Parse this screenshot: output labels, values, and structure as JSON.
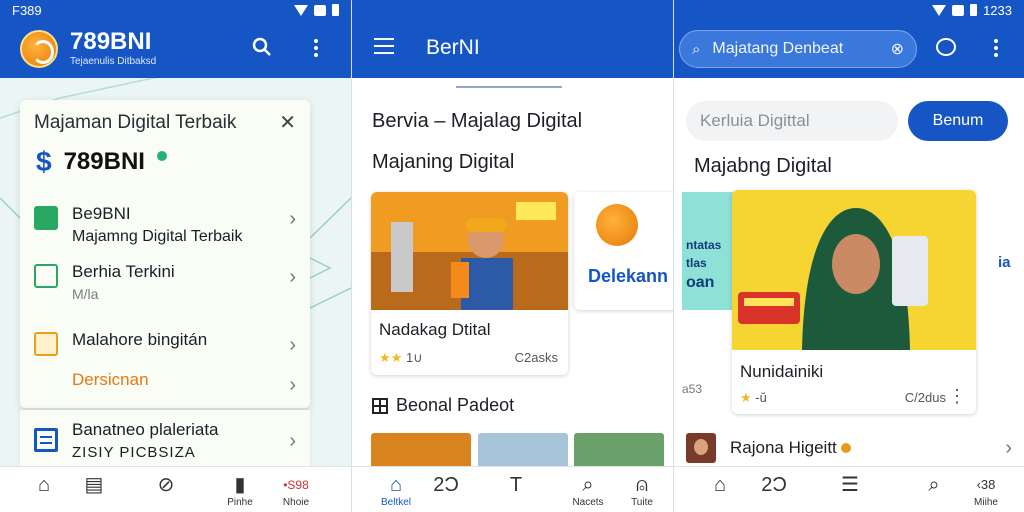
{
  "panel1": {
    "status_time": "F389",
    "brand_title": "789BNI",
    "brand_subtitle": "Tejaenulis Ditbaksd",
    "card_title": "Majaman Digital Terbaik",
    "card_brand": "789BNI",
    "menu": [
      {
        "label": "Be9BNI",
        "sub": "Majamng Digital Terbaik"
      },
      {
        "label": "Berhia Terkini",
        "sub": "M/la"
      },
      {
        "label": "Malahore bingitán",
        "sub": ""
      },
      {
        "label": "Dersicnan",
        "sub": ""
      }
    ],
    "card2": {
      "label": "Banatneo plaleriata",
      "sub": "ZISIY PICBSIZA"
    },
    "nav": [
      {
        "label": ""
      },
      {
        "label": ""
      },
      {
        "label": ""
      },
      {
        "label": "Pinhe"
      },
      {
        "label": "•S98",
        "sub": "Nhoie"
      }
    ]
  },
  "panel2": {
    "title": "BerNI",
    "heading1": "Bervia –   Majalag Digital",
    "heading2": "Majaning Digital",
    "card1": {
      "name": "Nadakag Dtital",
      "rating_text": "1∪",
      "count": "C2asks"
    },
    "card2": {
      "name": "Delekann"
    },
    "section_title": "Beonal Padeot",
    "nav": [
      {
        "label": "Beltkel",
        "glyph": "⌂"
      },
      {
        "label": "",
        "glyph": "2Ɔ"
      },
      {
        "label": "",
        "glyph": "T"
      },
      {
        "label": "Nacets",
        "glyph": "⌕"
      },
      {
        "label": "Tuite",
        "glyph": "⍝"
      }
    ]
  },
  "panel3": {
    "status_time": "1233",
    "search_text": "Majatang Denbeat",
    "input_placeholder": "Kerluia Digittal",
    "button_label": "Benum",
    "heading": "Majabng Digital",
    "strip_text": [
      "ntatas",
      "tlas",
      "oan"
    ],
    "card": {
      "name": "Nunidainiki",
      "rating_text": "-ŭ",
      "count": "C/2dus"
    },
    "side_text": [
      "a53",
      "ia"
    ],
    "list_name": "Rajona Higeitt",
    "nav": [
      {
        "label": "",
        "glyph": "⌂"
      },
      {
        "label": "",
        "glyph": "2Ɔ"
      },
      {
        "label": "",
        "glyph": "☰"
      },
      {
        "label": "",
        "glyph": "⌕"
      },
      {
        "label": "Miihe",
        "glyph": "‹38"
      }
    ]
  },
  "colors": {
    "primary": "#1656c4",
    "accent_orange": "#e57a12",
    "star": "#f2b824"
  }
}
